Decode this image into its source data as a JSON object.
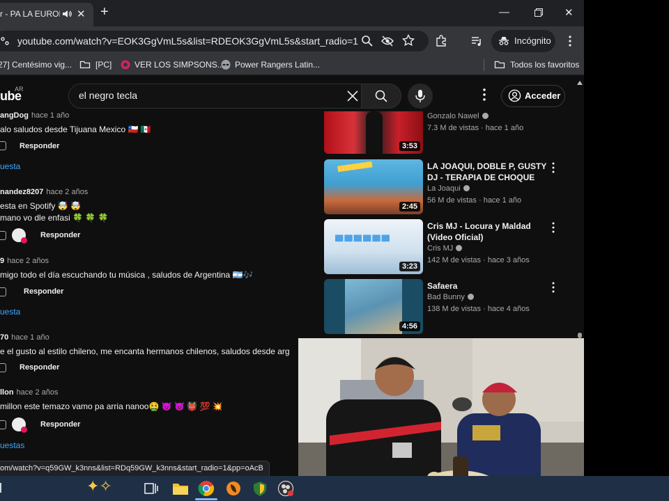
{
  "browser": {
    "tab_title": "r - PA LA EUROPA",
    "url": "youtube.com/watch?v=EOK3GgVmL5s&list=RDEOK3GgVmL5s&start_radio=1",
    "incognito_label": "Incógnito",
    "bookmarks": [
      {
        "label": "27] Centésimo vig..."
      },
      {
        "label": "[PC]"
      },
      {
        "label": "VER LOS SIMPSONS..."
      },
      {
        "label": "Power Rangers Latin..."
      }
    ],
    "all_bookmarks_label": "Todos los favoritos"
  },
  "youtube": {
    "logo_text": "ube",
    "logo_region": "AR",
    "search_value": "el negro tecla",
    "signin_label": "Acceder"
  },
  "comments": [
    {
      "author": "angDog",
      "time": "hace 1 año",
      "text": "alo saludos desde Tijuana Mexico 🇨🇱 🇲🇽",
      "reply": "Responder",
      "link": "uesta"
    },
    {
      "author": "nandez8207",
      "time": "hace 2 años",
      "text": "esta en Spotify 🤯 🤯",
      "text2": " mano vo dle enfasi 🍀 🍀 🍀",
      "reply": "Responder"
    },
    {
      "author": "9",
      "time": "hace 2 años",
      "text": "migo todo el día escuchando tu música , saludos de Argentina 🇦🇷🎶",
      "reply": "Responder",
      "link": "uesta"
    },
    {
      "author": "70",
      "time": "hace 1 año",
      "text": "e el gusto al estilo chileno, me encanta hermanos chilenos, saludos desde arg",
      "reply": "Responder"
    },
    {
      "author": "llon",
      "time": "hace 2 años",
      "text": "millon este temazo vamo pa arria nanoo🤮 😈 😈 👹 💯 💥",
      "reply": "Responder",
      "link": "uestas"
    }
  ],
  "videos": [
    {
      "title": "",
      "channel": "Gonzalo Nawel",
      "meta": "7.3 M de vistas · hace 1 año",
      "duration": "3:53"
    },
    {
      "title": "LA JOAQUI, DOBLE P, GUSTY DJ - TERAPIA DE CHOQUE (Video ...",
      "channel": "La Joaqui",
      "meta": "56 M de vistas · hace 1 año",
      "duration": "2:45"
    },
    {
      "title": "Cris MJ - Locura y Maldad (Video Oficial)",
      "channel": "Cris MJ",
      "meta": "142 M de vistas · hace 3 años",
      "duration": "3:23"
    },
    {
      "title": "Safaera",
      "channel": "Bad Bunny",
      "meta": "138 M de vistas · hace 4 años",
      "duration": "4:56"
    }
  ],
  "status_url": "om/watch?v=q59GW_k3nns&list=RDq59GW_k3nns&start_radio=1&pp=oAcB",
  "colors": {
    "link": "#3ea6ff",
    "taskbar": "#1f2f45"
  }
}
